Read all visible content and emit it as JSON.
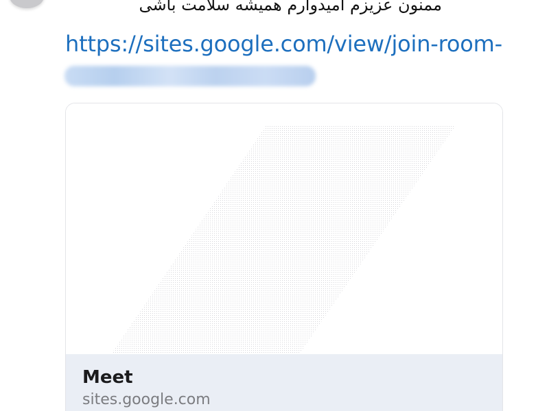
{
  "message": {
    "text": "ممنون عزیزم امیدوارم همیشه سلامت باشی"
  },
  "link": {
    "text": "https://sites.google.com/view/join-room-",
    "color": "#1d6fbe"
  },
  "preview_card": {
    "title": "Meet",
    "domain": "sites.google.com",
    "footer_bg": "#eaeef5"
  }
}
